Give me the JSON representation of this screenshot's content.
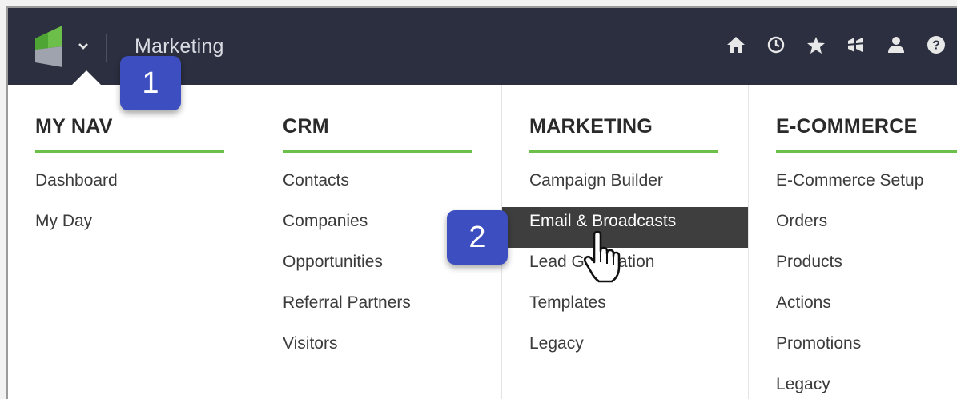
{
  "header": {
    "app_title": "Marketing",
    "icons": [
      "home-icon",
      "history-icon",
      "star-icon",
      "modules-icon",
      "user-icon",
      "help-icon"
    ]
  },
  "menu": {
    "columns": [
      {
        "heading": "MY NAV",
        "items": [
          "Dashboard",
          "My Day"
        ]
      },
      {
        "heading": "CRM",
        "items": [
          "Contacts",
          "Companies",
          "Opportunities",
          "Referral Partners",
          "Visitors"
        ]
      },
      {
        "heading": "MARKETING",
        "items": [
          "Campaign Builder",
          "Email & Broadcasts",
          "Lead Generation",
          "Templates",
          "Legacy"
        ],
        "active_index": 1
      },
      {
        "heading": "E-COMMERCE",
        "items": [
          "E-Commerce Setup",
          "Orders",
          "Products",
          "Actions",
          "Promotions",
          "Legacy"
        ]
      }
    ]
  },
  "callouts": [
    "1",
    "2"
  ],
  "colors": {
    "topbar": "#2b2f3f",
    "accent_green": "#6cc04a",
    "badge_blue": "#3d4fc0",
    "active_item": "#3e3e3e"
  }
}
